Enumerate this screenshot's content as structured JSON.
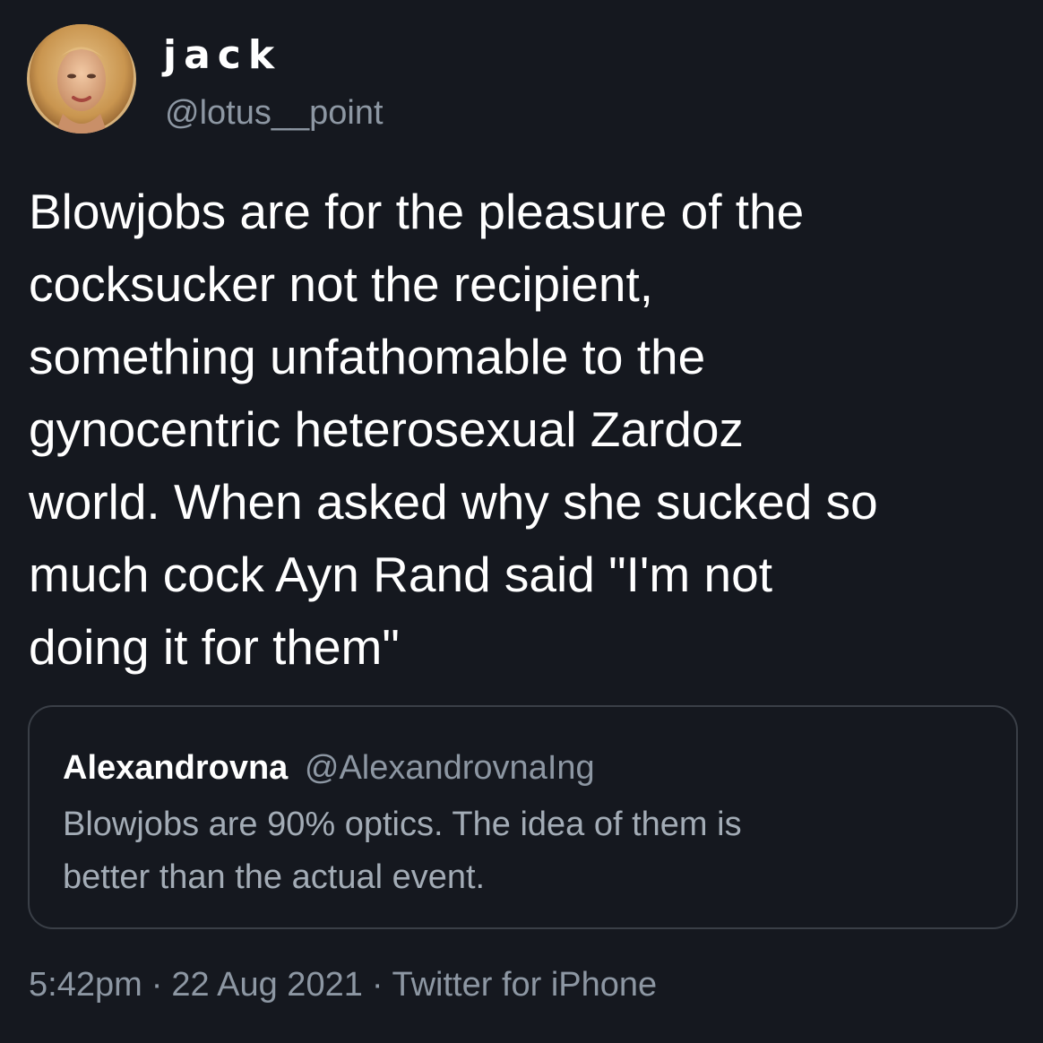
{
  "author": {
    "display_name": "jack",
    "handle": "@lotus__point",
    "avatar_icon": "profile-photo"
  },
  "tweet": {
    "text_lines": [
      "Blowjobs are for the pleasure of the",
      "cocksucker not the recipient,",
      "something unfathomable to the",
      "gynocentric heterosexual Zardoz",
      "world. When asked why she sucked so",
      "much cock Ayn Rand said \"I'm not",
      "doing it for them\""
    ]
  },
  "quoted_tweet": {
    "display_name": "Alexandrovna",
    "handle": "@AlexandrovnaIng",
    "text_lines": [
      "Blowjobs are 90% optics. The idea of them is",
      "better than the actual event."
    ]
  },
  "meta": {
    "time": "5:42pm",
    "date": "22 Aug 2021",
    "source": "Twitter for iPhone",
    "separator": "·"
  },
  "colors": {
    "background": "#15181f",
    "primary_text": "#ffffff",
    "secondary_text": "#8d97a3",
    "quote_border": "#3a3f47"
  }
}
